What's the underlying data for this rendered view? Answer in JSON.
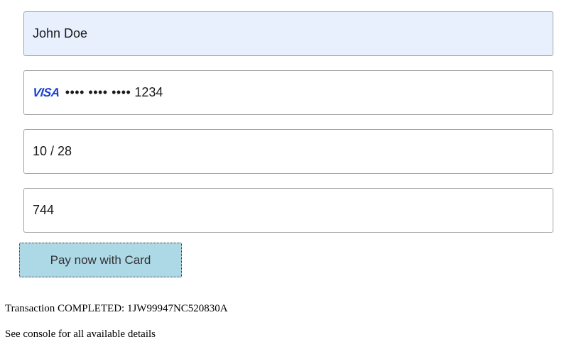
{
  "form": {
    "name_value": "John Doe",
    "card_brand": "VISA",
    "card_mask": "•••• •••• ••••",
    "card_last4": "1234",
    "expiry_value": "10 / 28",
    "cvv_value": "744"
  },
  "actions": {
    "pay_label": "Pay now with Card"
  },
  "status": {
    "transaction_text": "Transaction COMPLETED: 1JW99947NC520830A",
    "console_note": "See console for all available details"
  },
  "colors": {
    "autofill_bg": "#e8f0fe",
    "button_bg": "#add8e6",
    "visa_blue": "#1a3fd1"
  },
  "icons": {
    "card_brand_icon": "visa-icon"
  }
}
